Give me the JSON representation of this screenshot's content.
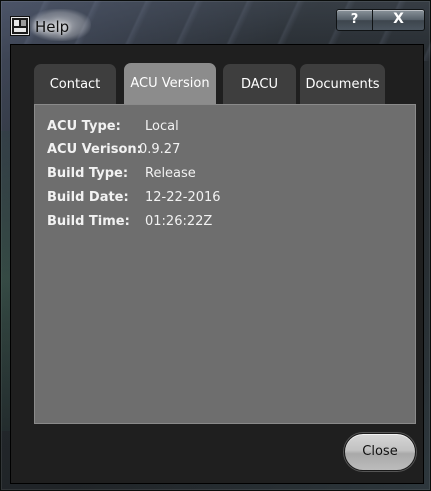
{
  "window": {
    "title": "Help",
    "help_button": "?",
    "close_button": "X"
  },
  "tabs": [
    {
      "label": "Contact",
      "active": false
    },
    {
      "label": "ACU Version",
      "active": true
    },
    {
      "label": "DACU",
      "active": false
    },
    {
      "label": "Documents",
      "active": false
    }
  ],
  "details": [
    {
      "label": "ACU Type:",
      "value": "Local"
    },
    {
      "label": "ACU Verison:",
      "value": "0.9.27"
    },
    {
      "label": "Build Type:",
      "value": "Release"
    },
    {
      "label": "Build Date:",
      "value": "12-22-2016"
    },
    {
      "label": "Build Time:",
      "value": "01:26:22Z"
    }
  ],
  "footer": {
    "close_label": "Close"
  },
  "colors": {
    "panel_bg": "#6e6e6e",
    "active_tab": "#8c8c8c",
    "inactive_tab": "#3e3e3e",
    "client_bg": "#1f1f1f"
  }
}
